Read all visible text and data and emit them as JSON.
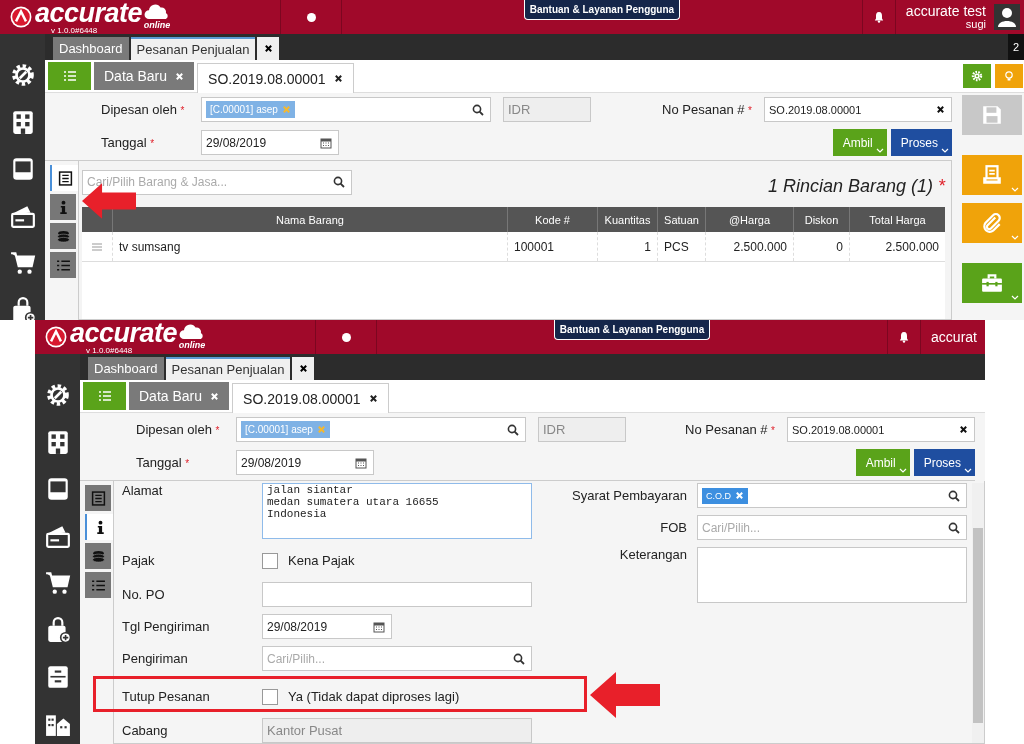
{
  "screens": [
    {
      "header": {
        "logo": "accurate",
        "logo_sub": "online",
        "version": "v 1.0.0#6448",
        "help": "Bantuan & Layanan Pengguna",
        "user_name": "accurate test",
        "user_sub": "sugi"
      },
      "module_tabs": [
        {
          "label": "Dashboard",
          "selected": false
        },
        {
          "label": "Pesanan Penjualan",
          "selected": true
        }
      ],
      "window_count": "2",
      "doc_tabs": [
        {
          "label": "Data Baru",
          "selected": false
        },
        {
          "label": "SO.2019.08.00001",
          "selected": true
        }
      ],
      "form": {
        "ordered_by": {
          "label": "Dipesan oleh",
          "mark": "*",
          "tag": "[C.00001] asep"
        },
        "currency": "IDR",
        "order_no": {
          "label": "No Pesanan #",
          "mark": "*",
          "value": "SO.2019.08.00001"
        },
        "date": {
          "label": "Tanggal",
          "mark": "*",
          "value": "29/08/2019"
        },
        "buttons": [
          "Ambil",
          "Proses"
        ]
      },
      "side_tabs": [
        {
          "selected": true
        },
        {
          "selected": false
        },
        {
          "selected": false
        },
        {
          "selected": false
        }
      ],
      "annotations": [
        {
          "kind": "arrow"
        }
      ],
      "body": {
        "kind": "items",
        "search_placeholder": "Cari/Pilih Barang & Jasa...",
        "title": "1 Rincian Barang (1)",
        "title_mark": "*",
        "columns": [
          "Nama Barang",
          "Kode #",
          "Kuantitas",
          "Satuan",
          "@Harga",
          "Diskon",
          "Total Harga"
        ],
        "rows": [
          [
            "tv sumsang",
            "100001",
            "1",
            "PCS",
            "2.500.000",
            "0",
            "2.500.000"
          ]
        ]
      }
    },
    {
      "header": {
        "logo": "accurate",
        "logo_sub": "online",
        "version": "v 1.0.0#6448",
        "help": "Bantuan & Layanan Pengguna",
        "user_name": "accurat"
      },
      "module_tabs": [
        {
          "label": "Dashboard",
          "selected": false
        },
        {
          "label": "Pesanan Penjualan",
          "selected": true
        }
      ],
      "doc_tabs": [
        {
          "label": "Data Baru",
          "selected": false
        },
        {
          "label": "SO.2019.08.00001",
          "selected": true
        }
      ],
      "form": {
        "ordered_by": {
          "label": "Dipesan oleh",
          "mark": "*",
          "tag": "[C.00001] asep"
        },
        "currency": "IDR",
        "order_no": {
          "label": "No Pesanan #",
          "mark": "*",
          "value": "SO.2019.08.00001"
        },
        "date": {
          "label": "Tanggal",
          "mark": "*",
          "value": "29/08/2019"
        },
        "buttons": [
          "Ambil",
          "Proses"
        ]
      },
      "side_tabs": [
        {
          "selected": false
        },
        {
          "selected": true
        },
        {
          "selected": false
        },
        {
          "selected": false
        }
      ],
      "annotations": [
        {
          "kind": "frame"
        },
        {
          "kind": "arrow"
        }
      ],
      "body": {
        "kind": "info",
        "left": [
          {
            "kind": "textarea",
            "label": "Alamat",
            "value": "jalan siantar\nmedan sumatera utara 16655\nIndonesia"
          },
          {
            "kind": "checkbox",
            "label": "Pajak",
            "option": "Kena Pajak",
            "checked": false
          },
          {
            "kind": "text",
            "label": "No. PO"
          },
          {
            "kind": "date",
            "label": "Tgl Pengiriman",
            "value": "29/08/2019"
          },
          {
            "kind": "lookup",
            "label": "Pengiriman",
            "placeholder": "Cari/Pilih..."
          },
          {
            "kind": "checkbox",
            "label": "Tutup Pesanan",
            "option": "Ya (Tidak dapat diproses lagi)",
            "checked": false
          },
          {
            "kind": "readonly",
            "label": "Cabang",
            "value": "Kantor Pusat"
          }
        ],
        "right": [
          {
            "kind": "lookup",
            "label": "Syarat Pembayaran",
            "tag": "C.O.D"
          },
          {
            "kind": "lookup",
            "label": "FOB",
            "placeholder": "Cari/Pilih..."
          },
          {
            "kind": "textarea",
            "label": "Keterangan"
          }
        ]
      }
    }
  ]
}
